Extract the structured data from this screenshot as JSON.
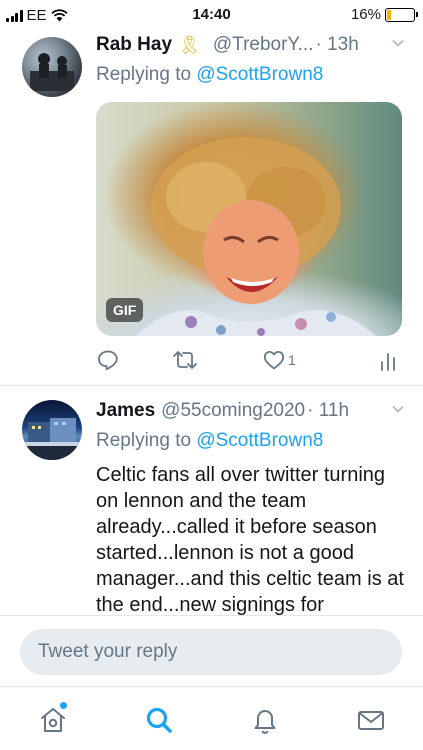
{
  "status_bar": {
    "carrier": "EE",
    "time": "14:40",
    "battery": "16%",
    "battery_level": 0.16
  },
  "tweets": [
    {
      "name": "Rab Hay",
      "badge_emoji": "🎗",
      "handle": "@TreborY...",
      "time": "· 13h",
      "replying_prefix": "Replying to",
      "replying_to": "@ScottBrown8",
      "media_badge": "GIF",
      "like_count": "1"
    },
    {
      "name": "James",
      "handle": "@55coming2020",
      "time": "· 11h",
      "replying_prefix": "Replying to",
      "replying_to": "@ScottBrown8",
      "text": "Celtic fans all over twitter turning on lennon and the team already...called it before season started...lennon is not a good manager...and this celtic team is at the end...new signings for"
    }
  ],
  "reply_box": {
    "placeholder": "Tweet your reply"
  },
  "tabs": [
    {
      "icon": "home-icon",
      "active": false
    },
    {
      "icon": "search-icon",
      "active": true
    },
    {
      "icon": "notifications-bell-icon",
      "active": false
    },
    {
      "icon": "messages-envelope-icon",
      "active": false
    }
  ],
  "colors": {
    "accent": "#1da1f2",
    "secondary_text": "#657786",
    "battery": "#f7b500"
  }
}
